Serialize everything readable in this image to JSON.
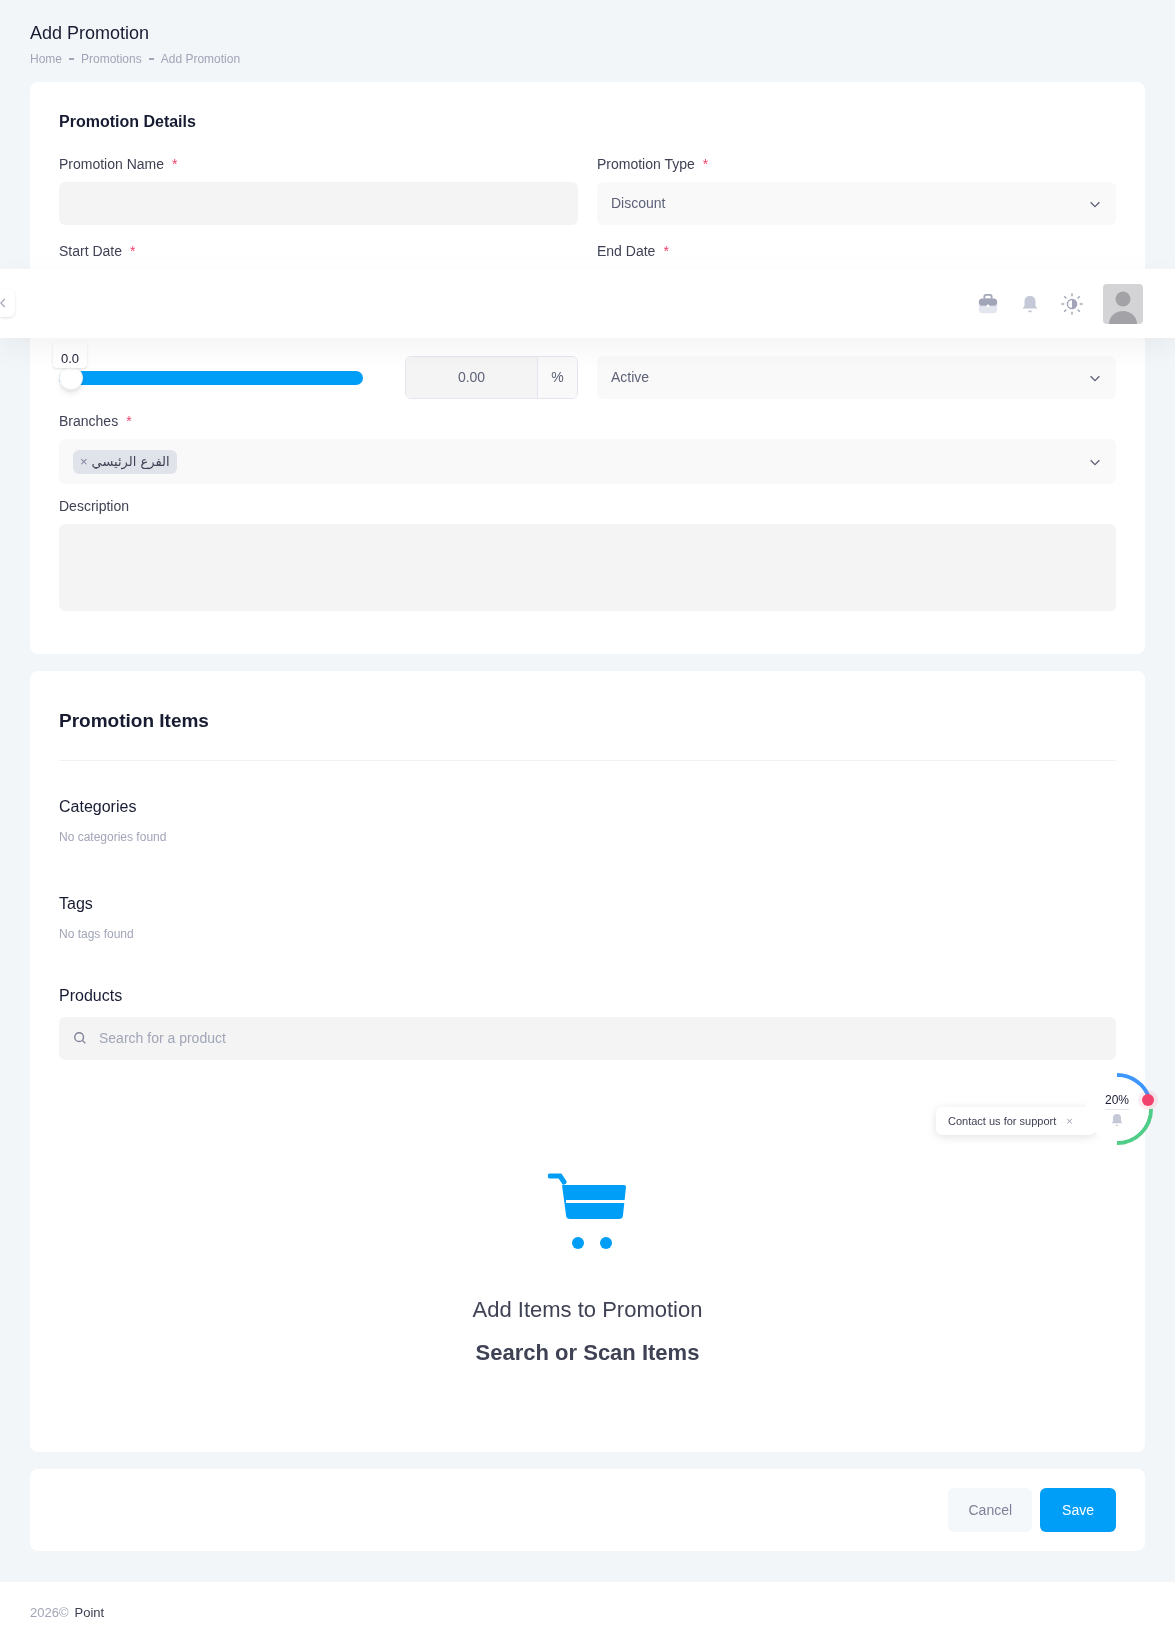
{
  "page": {
    "title": "Add Promotion",
    "breadcrumb": [
      "Home",
      "Promotions",
      "Add Promotion"
    ]
  },
  "required_mark": "*",
  "details": {
    "title": "Promotion Details",
    "promotion_name": {
      "label": "Promotion Name",
      "required": true
    },
    "promotion_type": {
      "label": "Promotion Type",
      "required": true,
      "value": "Discount"
    },
    "start_date": {
      "label": "Start Date",
      "required": true
    },
    "end_date": {
      "label": "End Date",
      "required": true
    },
    "discount": {
      "tooltip": "0.0",
      "level": 0,
      "value": "0.00",
      "unit": "%"
    },
    "status": {
      "value": "Active"
    },
    "branches": {
      "label": "Branches",
      "required": true,
      "chips": [
        {
          "label": "الفرع الرئيسي",
          "remove": "×"
        }
      ]
    },
    "description": {
      "label": "Description"
    }
  },
  "items": {
    "title": "Promotion Items",
    "sections": [
      {
        "title": "Categories",
        "empty": "No categories found"
      },
      {
        "title": "Tags",
        "empty": "No tags found"
      }
    ],
    "products": {
      "title": "Products",
      "placeholder": "Search for a product"
    },
    "empty_state": {
      "title": "Add Items to Promotion",
      "subtitle": "Search or Scan Items"
    }
  },
  "actions": [
    {
      "label": "Cancel",
      "kind": "secondary"
    },
    {
      "label": "Save",
      "kind": "primary"
    }
  ],
  "support": {
    "label": "Contact us for support",
    "close": "×",
    "progress": "20%"
  },
  "footer": {
    "year": "2026©",
    "brand": "Point"
  }
}
